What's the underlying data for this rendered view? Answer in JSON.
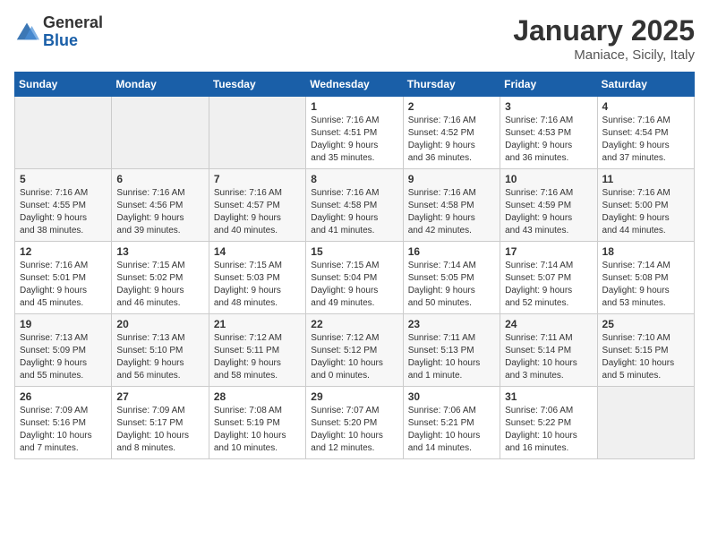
{
  "logo": {
    "general": "General",
    "blue": "Blue"
  },
  "calendar": {
    "title": "January 2025",
    "subtitle": "Maniace, Sicily, Italy"
  },
  "weekdays": [
    "Sunday",
    "Monday",
    "Tuesday",
    "Wednesday",
    "Thursday",
    "Friday",
    "Saturday"
  ],
  "weeks": [
    [
      {
        "day": "",
        "detail": ""
      },
      {
        "day": "",
        "detail": ""
      },
      {
        "day": "",
        "detail": ""
      },
      {
        "day": "1",
        "detail": "Sunrise: 7:16 AM\nSunset: 4:51 PM\nDaylight: 9 hours\nand 35 minutes."
      },
      {
        "day": "2",
        "detail": "Sunrise: 7:16 AM\nSunset: 4:52 PM\nDaylight: 9 hours\nand 36 minutes."
      },
      {
        "day": "3",
        "detail": "Sunrise: 7:16 AM\nSunset: 4:53 PM\nDaylight: 9 hours\nand 36 minutes."
      },
      {
        "day": "4",
        "detail": "Sunrise: 7:16 AM\nSunset: 4:54 PM\nDaylight: 9 hours\nand 37 minutes."
      }
    ],
    [
      {
        "day": "5",
        "detail": "Sunrise: 7:16 AM\nSunset: 4:55 PM\nDaylight: 9 hours\nand 38 minutes."
      },
      {
        "day": "6",
        "detail": "Sunrise: 7:16 AM\nSunset: 4:56 PM\nDaylight: 9 hours\nand 39 minutes."
      },
      {
        "day": "7",
        "detail": "Sunrise: 7:16 AM\nSunset: 4:57 PM\nDaylight: 9 hours\nand 40 minutes."
      },
      {
        "day": "8",
        "detail": "Sunrise: 7:16 AM\nSunset: 4:58 PM\nDaylight: 9 hours\nand 41 minutes."
      },
      {
        "day": "9",
        "detail": "Sunrise: 7:16 AM\nSunset: 4:58 PM\nDaylight: 9 hours\nand 42 minutes."
      },
      {
        "day": "10",
        "detail": "Sunrise: 7:16 AM\nSunset: 4:59 PM\nDaylight: 9 hours\nand 43 minutes."
      },
      {
        "day": "11",
        "detail": "Sunrise: 7:16 AM\nSunset: 5:00 PM\nDaylight: 9 hours\nand 44 minutes."
      }
    ],
    [
      {
        "day": "12",
        "detail": "Sunrise: 7:16 AM\nSunset: 5:01 PM\nDaylight: 9 hours\nand 45 minutes."
      },
      {
        "day": "13",
        "detail": "Sunrise: 7:15 AM\nSunset: 5:02 PM\nDaylight: 9 hours\nand 46 minutes."
      },
      {
        "day": "14",
        "detail": "Sunrise: 7:15 AM\nSunset: 5:03 PM\nDaylight: 9 hours\nand 48 minutes."
      },
      {
        "day": "15",
        "detail": "Sunrise: 7:15 AM\nSunset: 5:04 PM\nDaylight: 9 hours\nand 49 minutes."
      },
      {
        "day": "16",
        "detail": "Sunrise: 7:14 AM\nSunset: 5:05 PM\nDaylight: 9 hours\nand 50 minutes."
      },
      {
        "day": "17",
        "detail": "Sunrise: 7:14 AM\nSunset: 5:07 PM\nDaylight: 9 hours\nand 52 minutes."
      },
      {
        "day": "18",
        "detail": "Sunrise: 7:14 AM\nSunset: 5:08 PM\nDaylight: 9 hours\nand 53 minutes."
      }
    ],
    [
      {
        "day": "19",
        "detail": "Sunrise: 7:13 AM\nSunset: 5:09 PM\nDaylight: 9 hours\nand 55 minutes."
      },
      {
        "day": "20",
        "detail": "Sunrise: 7:13 AM\nSunset: 5:10 PM\nDaylight: 9 hours\nand 56 minutes."
      },
      {
        "day": "21",
        "detail": "Sunrise: 7:12 AM\nSunset: 5:11 PM\nDaylight: 9 hours\nand 58 minutes."
      },
      {
        "day": "22",
        "detail": "Sunrise: 7:12 AM\nSunset: 5:12 PM\nDaylight: 10 hours\nand 0 minutes."
      },
      {
        "day": "23",
        "detail": "Sunrise: 7:11 AM\nSunset: 5:13 PM\nDaylight: 10 hours\nand 1 minute."
      },
      {
        "day": "24",
        "detail": "Sunrise: 7:11 AM\nSunset: 5:14 PM\nDaylight: 10 hours\nand 3 minutes."
      },
      {
        "day": "25",
        "detail": "Sunrise: 7:10 AM\nSunset: 5:15 PM\nDaylight: 10 hours\nand 5 minutes."
      }
    ],
    [
      {
        "day": "26",
        "detail": "Sunrise: 7:09 AM\nSunset: 5:16 PM\nDaylight: 10 hours\nand 7 minutes."
      },
      {
        "day": "27",
        "detail": "Sunrise: 7:09 AM\nSunset: 5:17 PM\nDaylight: 10 hours\nand 8 minutes."
      },
      {
        "day": "28",
        "detail": "Sunrise: 7:08 AM\nSunset: 5:19 PM\nDaylight: 10 hours\nand 10 minutes."
      },
      {
        "day": "29",
        "detail": "Sunrise: 7:07 AM\nSunset: 5:20 PM\nDaylight: 10 hours\nand 12 minutes."
      },
      {
        "day": "30",
        "detail": "Sunrise: 7:06 AM\nSunset: 5:21 PM\nDaylight: 10 hours\nand 14 minutes."
      },
      {
        "day": "31",
        "detail": "Sunrise: 7:06 AM\nSunset: 5:22 PM\nDaylight: 10 hours\nand 16 minutes."
      },
      {
        "day": "",
        "detail": ""
      }
    ]
  ]
}
